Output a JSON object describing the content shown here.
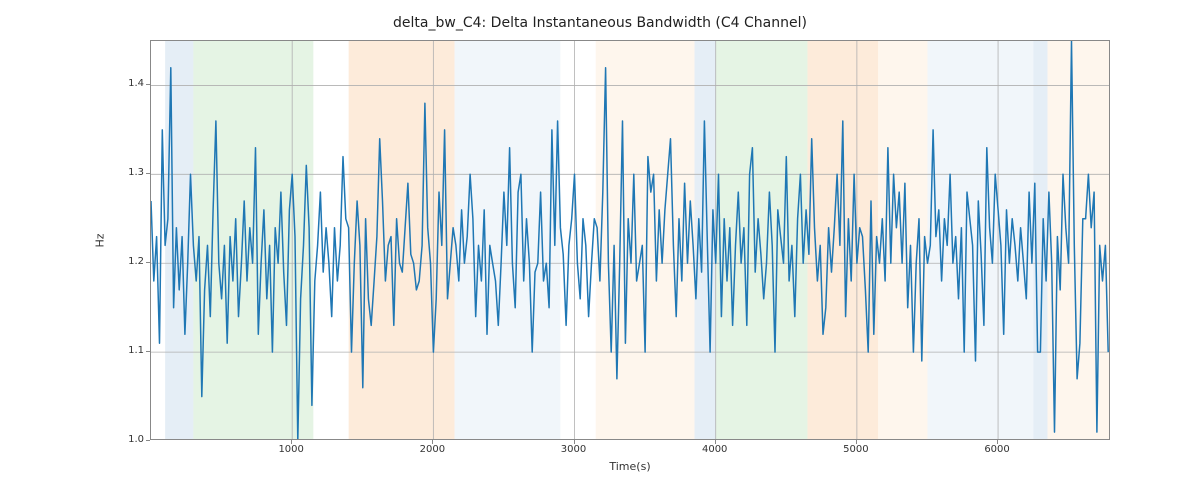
{
  "chart_data": {
    "type": "line",
    "title": "delta_bw_C4: Delta Instantaneous Bandwidth (C4 Channel)",
    "xlabel": "Time(s)",
    "ylabel": "Hz",
    "xlim": [
      0,
      6800
    ],
    "ylim": [
      1.0,
      1.45
    ],
    "x_ticks": [
      1000,
      2000,
      3000,
      4000,
      5000,
      6000
    ],
    "y_ticks": [
      1.0,
      1.1,
      1.2,
      1.3,
      1.4
    ],
    "bands": [
      {
        "x0": 100,
        "x1": 300,
        "color": "#a9c7e1"
      },
      {
        "x0": 300,
        "x1": 1150,
        "color": "#a8d9a5"
      },
      {
        "x0": 1400,
        "x1": 2150,
        "color": "#f7be86"
      },
      {
        "x0": 2150,
        "x1": 2900,
        "color": "#cfe0ee"
      },
      {
        "x0": 3150,
        "x1": 3850,
        "color": "#fde2c4"
      },
      {
        "x0": 3850,
        "x1": 4000,
        "color": "#a9c7e1"
      },
      {
        "x0": 4000,
        "x1": 4650,
        "color": "#a8d9a5"
      },
      {
        "x0": 4650,
        "x1": 5150,
        "color": "#f7be86"
      },
      {
        "x0": 5150,
        "x1": 5500,
        "color": "#fde2c4"
      },
      {
        "x0": 5500,
        "x1": 6250,
        "color": "#cfe0ee"
      },
      {
        "x0": 6250,
        "x1": 6350,
        "color": "#a9c7e1"
      },
      {
        "x0": 6350,
        "x1": 6800,
        "color": "#fde2c4"
      }
    ],
    "series": [
      {
        "name": "delta_bw_C4",
        "color": "#1f77b4",
        "x_step": 20,
        "values": [
          1.27,
          1.18,
          1.23,
          1.11,
          1.35,
          1.22,
          1.25,
          1.42,
          1.15,
          1.24,
          1.17,
          1.23,
          1.12,
          1.2,
          1.3,
          1.22,
          1.18,
          1.23,
          1.05,
          1.17,
          1.22,
          1.14,
          1.26,
          1.36,
          1.2,
          1.16,
          1.22,
          1.11,
          1.23,
          1.18,
          1.25,
          1.14,
          1.2,
          1.27,
          1.18,
          1.24,
          1.2,
          1.33,
          1.12,
          1.2,
          1.26,
          1.16,
          1.22,
          1.1,
          1.24,
          1.2,
          1.28,
          1.19,
          1.13,
          1.26,
          1.3,
          1.23,
          1.0,
          1.16,
          1.22,
          1.31,
          1.24,
          1.04,
          1.18,
          1.22,
          1.28,
          1.19,
          1.24,
          1.2,
          1.14,
          1.24,
          1.18,
          1.22,
          1.32,
          1.25,
          1.24,
          1.1,
          1.2,
          1.27,
          1.22,
          1.06,
          1.25,
          1.16,
          1.13,
          1.18,
          1.23,
          1.34,
          1.27,
          1.18,
          1.22,
          1.23,
          1.13,
          1.25,
          1.2,
          1.19,
          1.24,
          1.29,
          1.21,
          1.2,
          1.17,
          1.18,
          1.22,
          1.38,
          1.24,
          1.2,
          1.1,
          1.16,
          1.28,
          1.22,
          1.35,
          1.16,
          1.2,
          1.24,
          1.22,
          1.18,
          1.26,
          1.2,
          1.23,
          1.3,
          1.25,
          1.14,
          1.22,
          1.18,
          1.26,
          1.12,
          1.22,
          1.2,
          1.18,
          1.13,
          1.2,
          1.28,
          1.22,
          1.33,
          1.2,
          1.15,
          1.28,
          1.3,
          1.18,
          1.25,
          1.2,
          1.1,
          1.19,
          1.2,
          1.28,
          1.18,
          1.2,
          1.15,
          1.35,
          1.22,
          1.36,
          1.24,
          1.21,
          1.13,
          1.22,
          1.25,
          1.3,
          1.2,
          1.16,
          1.25,
          1.22,
          1.14,
          1.2,
          1.25,
          1.24,
          1.18,
          1.28,
          1.42,
          1.2,
          1.1,
          1.22,
          1.07,
          1.2,
          1.36,
          1.11,
          1.25,
          1.2,
          1.3,
          1.18,
          1.2,
          1.22,
          1.1,
          1.32,
          1.28,
          1.3,
          1.18,
          1.26,
          1.2,
          1.26,
          1.3,
          1.34,
          1.22,
          1.14,
          1.25,
          1.18,
          1.29,
          1.2,
          1.27,
          1.22,
          1.16,
          1.25,
          1.19,
          1.36,
          1.23,
          1.1,
          1.26,
          1.2,
          1.3,
          1.14,
          1.25,
          1.18,
          1.24,
          1.13,
          1.22,
          1.28,
          1.2,
          1.24,
          1.13,
          1.3,
          1.33,
          1.19,
          1.25,
          1.21,
          1.16,
          1.2,
          1.28,
          1.22,
          1.1,
          1.26,
          1.23,
          1.2,
          1.32,
          1.18,
          1.22,
          1.14,
          1.25,
          1.3,
          1.2,
          1.26,
          1.21,
          1.34,
          1.24,
          1.18,
          1.22,
          1.12,
          1.15,
          1.24,
          1.19,
          1.24,
          1.3,
          1.22,
          1.36,
          1.14,
          1.25,
          1.18,
          1.3,
          1.2,
          1.24,
          1.23,
          1.17,
          1.1,
          1.27,
          1.12,
          1.23,
          1.2,
          1.25,
          1.18,
          1.33,
          1.2,
          1.3,
          1.24,
          1.28,
          1.2,
          1.29,
          1.15,
          1.22,
          1.1,
          1.2,
          1.25,
          1.09,
          1.23,
          1.2,
          1.22,
          1.35,
          1.23,
          1.26,
          1.18,
          1.25,
          1.22,
          1.3,
          1.2,
          1.23,
          1.16,
          1.24,
          1.1,
          1.28,
          1.25,
          1.22,
          1.09,
          1.27,
          1.21,
          1.13,
          1.33,
          1.24,
          1.2,
          1.3,
          1.26,
          1.22,
          1.12,
          1.26,
          1.2,
          1.25,
          1.22,
          1.18,
          1.24,
          1.2,
          1.16,
          1.28,
          1.2,
          1.29,
          1.1,
          1.1,
          1.25,
          1.18,
          1.28,
          1.2,
          1.01,
          1.23,
          1.17,
          1.3,
          1.24,
          1.2,
          1.45,
          1.22,
          1.07,
          1.11,
          1.25,
          1.25,
          1.3,
          1.24,
          1.28,
          1.01,
          1.22,
          1.18,
          1.22,
          1.1
        ]
      }
    ]
  }
}
